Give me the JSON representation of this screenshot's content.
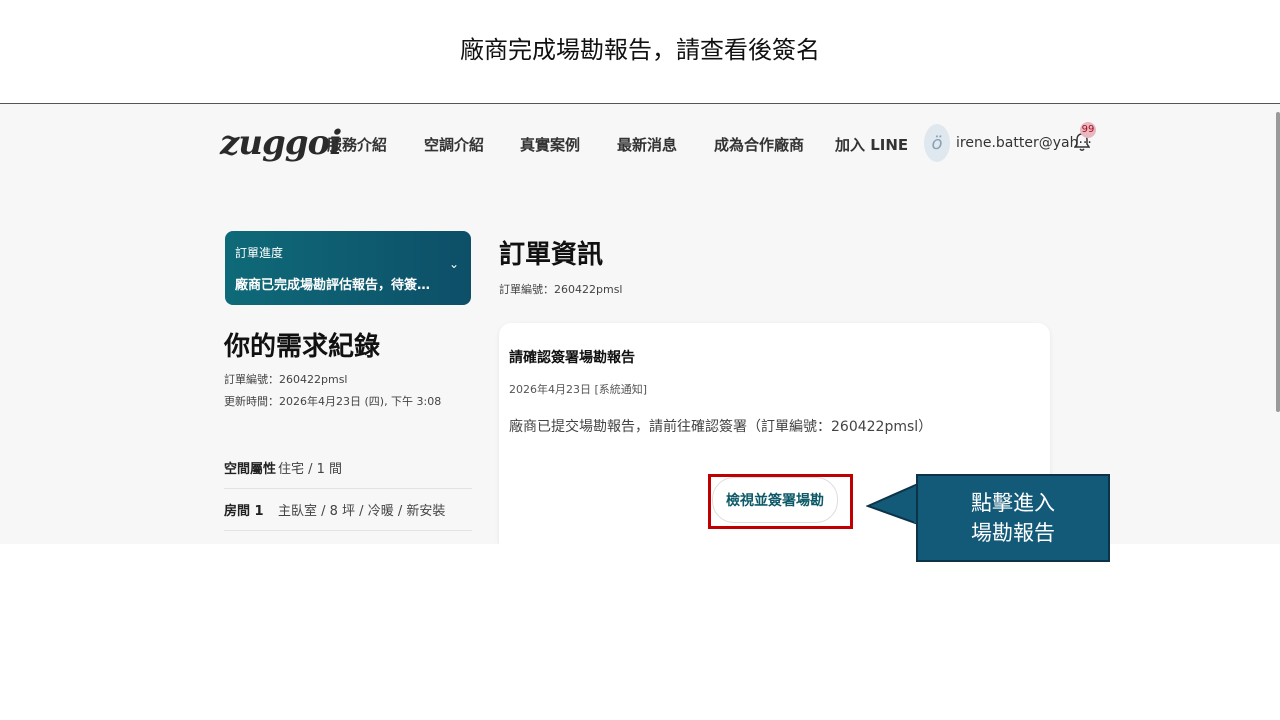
{
  "slide": {
    "title": "廠商完成場勘報告，請查看後簽名"
  },
  "nav": {
    "logo": "zuggoi",
    "items": [
      "服務介紹",
      "空調介紹",
      "真實案例",
      "最新消息",
      "成為合作廠商",
      "加入 LINE"
    ],
    "user_email": "irene.batter@yah···",
    "notification_count": "99"
  },
  "progress": {
    "label": "訂單進度",
    "status": "廠商已完成場勘評估報告，待簽名…"
  },
  "requirements": {
    "title": "你的需求紀錄",
    "order_no": "訂單編號：260422pmsl",
    "updated": "更新時間：2026年4月23日 (四), 下午 3:08",
    "rows": [
      {
        "label": "空間屬性",
        "value": "住宅 / 1 間"
      },
      {
        "label": "房間 1",
        "value": "主臥室 / 8 坪 / 冷暖 / 新安裝"
      }
    ]
  },
  "order": {
    "title": "訂單資訊",
    "order_no": "訂單編號：260422pmsl",
    "notice": {
      "title": "請確認簽署場勘報告",
      "date": "2026年4月23日 [系統通知]",
      "body": "廠商已提交場勘報告，請前往確認簽署（訂單編號：260422pmsl）",
      "button_label": "檢視並簽署場勘"
    }
  },
  "callout": {
    "line1": "點擊進入",
    "line2": "場勘報告"
  },
  "colors": {
    "accent": "#0d5968",
    "callout": "#135a79",
    "highlight": "#c00000"
  },
  "icons": {
    "dropdown": "chevron-down-icon",
    "notifications": "bell-icon",
    "avatar": "avatar-icon"
  }
}
